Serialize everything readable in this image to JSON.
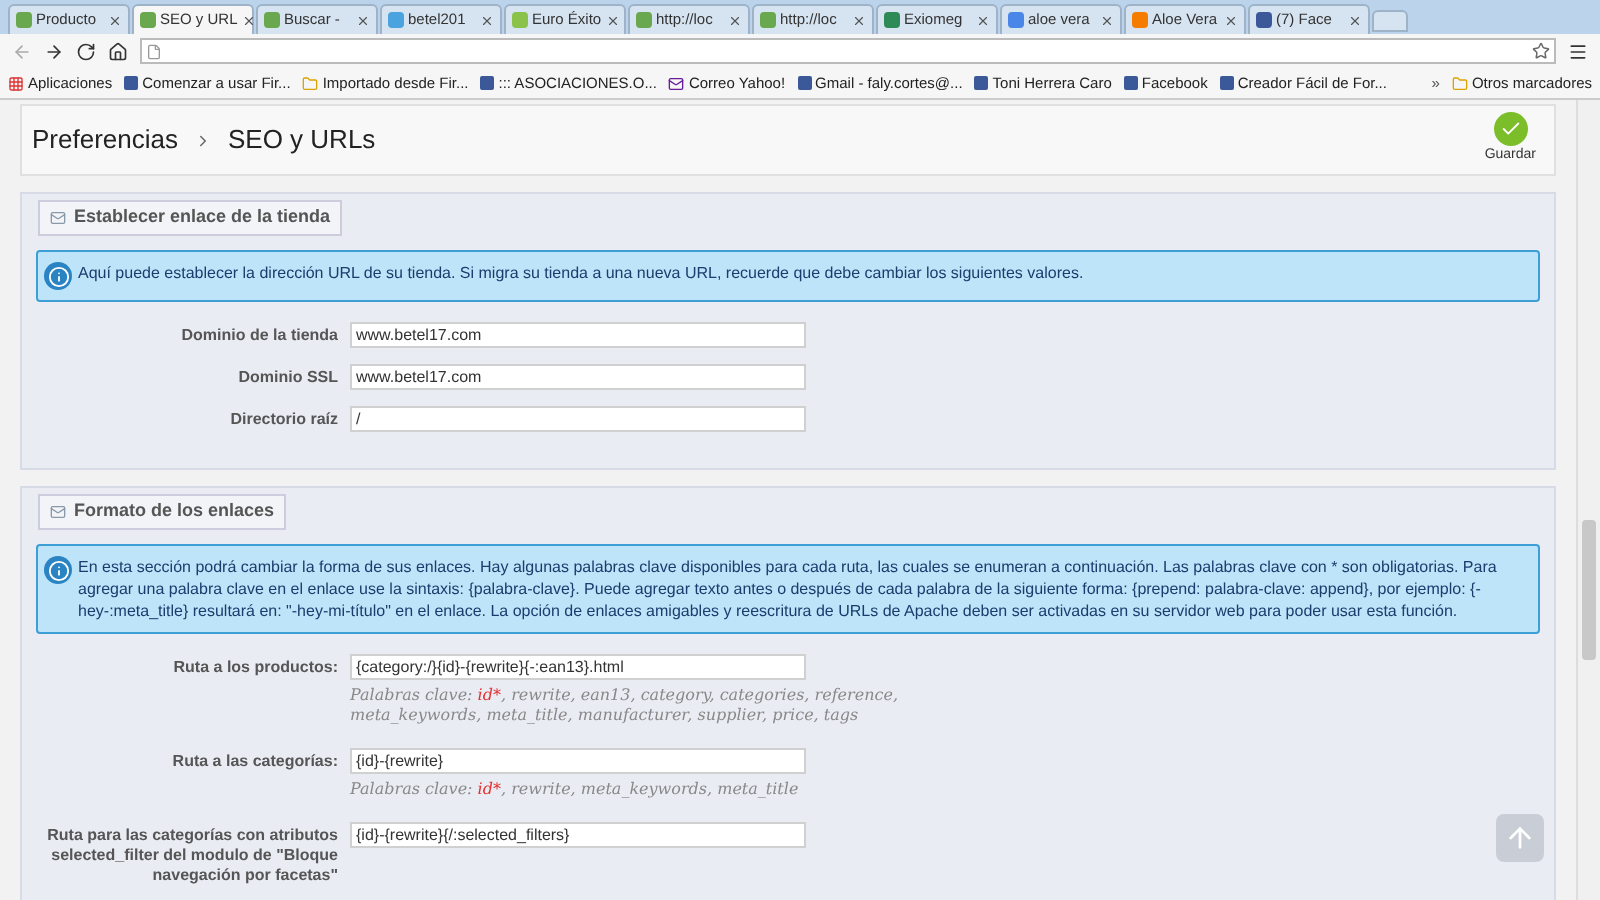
{
  "tabs": [
    {
      "label": "Producto",
      "selected": false,
      "color": "#6aa84f"
    },
    {
      "label": "SEO y URL",
      "selected": true,
      "color": "#6aa84f"
    },
    {
      "label": "Buscar - ",
      "selected": false,
      "color": "#6aa84f"
    },
    {
      "label": "betel201",
      "selected": false,
      "color": "#4aa3df"
    },
    {
      "label": "Euro Éxito",
      "selected": false,
      "color": "#8bc34a"
    },
    {
      "label": "http://loc",
      "selected": false,
      "color": "#6aa84f"
    },
    {
      "label": "http://loc",
      "selected": false,
      "color": "#6aa84f"
    },
    {
      "label": "Exiomeg",
      "selected": false,
      "color": "#2e8b57"
    },
    {
      "label": "aloe vera",
      "selected": false,
      "color": "#4a86e8"
    },
    {
      "label": "Aloe Vera",
      "selected": false,
      "color": "#f57c00"
    },
    {
      "label": "(7) Face",
      "selected": false,
      "color": "#3b5998"
    }
  ],
  "bookmarks": [
    "Aplicaciones",
    "Comenzar a usar Fir...",
    "Importado desde Fir...",
    "::: ASOCIACIONES.O...",
    "Correo Yahoo!",
    "Gmail - faly.cortes@...",
    "Toni Herrera Caro",
    "Facebook",
    "Creador Fácil de For..."
  ],
  "bookmarks_more": "»",
  "other_bookmarks": "Otros marcadores",
  "breadcrumb": [
    "Preferencias",
    "SEO y URLs"
  ],
  "save_button": "Guardar",
  "sections": [
    {
      "title": "Establecer enlace de la tienda",
      "info": "Aquí puede establecer la dirección URL de su tienda. Si migra su tienda a una nueva URL, recuerde que debe cambiar los siguientes valores.",
      "fields": [
        {
          "label": "Dominio de la tienda",
          "value": "www.betel17.com"
        },
        {
          "label": "Dominio SSL",
          "value": "www.betel17.com"
        },
        {
          "label": "Directorio raíz",
          "value": "/"
        }
      ]
    },
    {
      "title": "Formato de los enlaces",
      "info": "En esta sección podrá cambiar la forma de sus enlaces. Hay algunas palabras clave disponibles para cada ruta, las cuales se enumeran a continuación. Las palabras clave con * son obligatorias. Para agregar una palabra clave en el enlace use la sintaxis: {palabra-clave}. Puede agregar texto antes o después de cada palabra de la siguiente forma: {prepend: palabra-clave: append}, por ejemplo: {-hey-:meta_title} resultará en: \"-hey-mi-título\" en el enlace. La opción de enlaces amigables y reescritura de URLs de Apache deben ser activadas en su servidor web para poder usar esta función.",
      "fields": [
        {
          "label": "Ruta a los productos:",
          "value": "{category:/}{id}-{rewrite}{-:ean13}.html",
          "hint_label": "Palabras clave:",
          "required_keywords": "id*",
          "keywords": ", rewrite, ean13, category, categories, reference, meta_keywords, meta_title, manufacturer, supplier, price, tags"
        },
        {
          "label": "Ruta a las categorías:",
          "value": "{id}-{rewrite}",
          "hint_label": "Palabras clave:",
          "required_keywords": "id*",
          "keywords": ", rewrite, meta_keywords, meta_title"
        },
        {
          "label": "Ruta para las categorías con atributos selected_filter del modulo de \"Bloque navegación por facetas\"",
          "value": "{id}-{rewrite}{/:selected_filters}"
        }
      ]
    }
  ]
}
